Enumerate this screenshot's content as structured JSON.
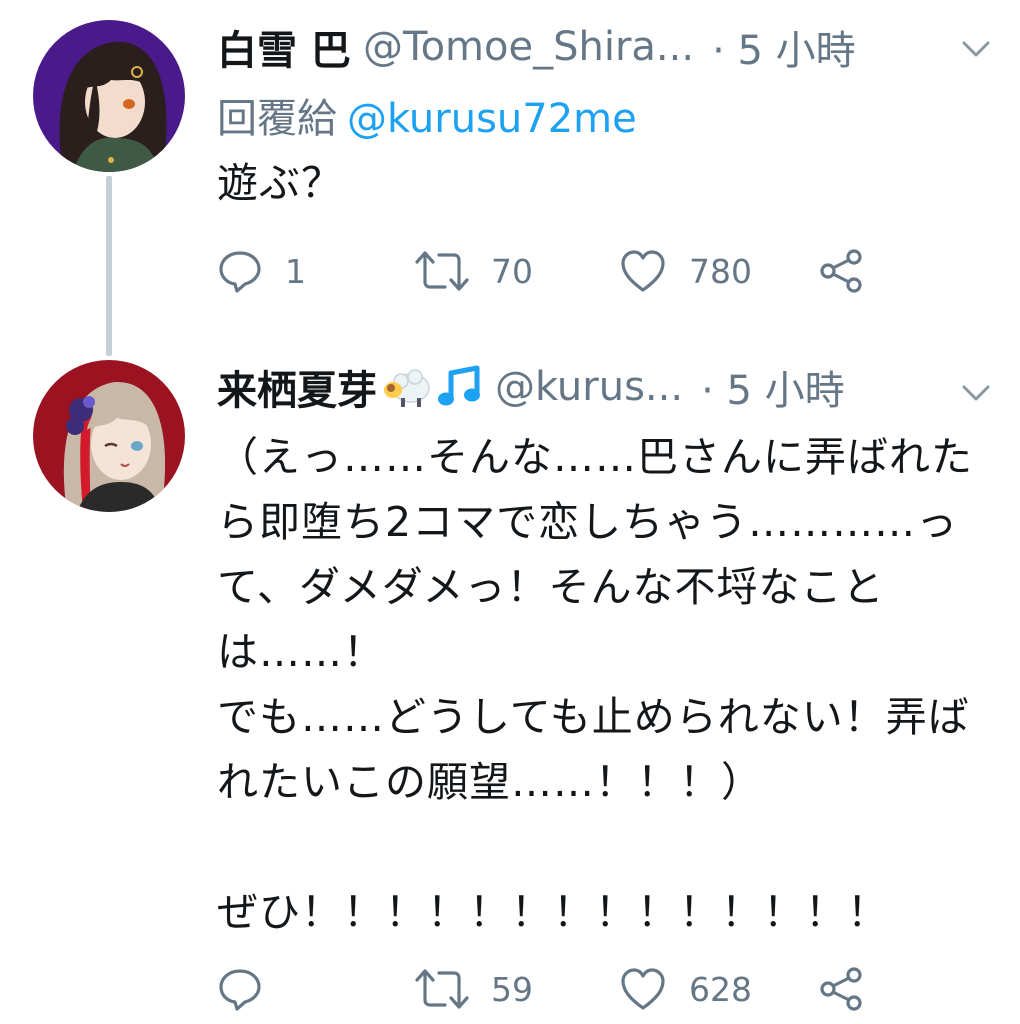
{
  "tweets": [
    {
      "display_name": "白雪 巴",
      "handle": "@Tomoe_Shira...",
      "time": "· 5 小時",
      "reply_label": "回覆給",
      "reply_mention": "@kurusu72me",
      "text": "遊ぶ？",
      "replies": "1",
      "retweets": "70",
      "likes": "780",
      "avatar_colors": {
        "bg": "#4a1a8a",
        "hair": "#2a1f1c",
        "skin": "#f4dccd",
        "outfit": "#3e5a45"
      }
    },
    {
      "display_name": "来栖夏芽",
      "emoji": [
        "sheep-emoji",
        "music-note-emoji"
      ],
      "handle": "@kurus...",
      "time": "· 5 小時",
      "text": "（えっ……そんな……巴さんに弄ばれたら即堕ち2コマで恋しちゃう…………って、ダメダメっ！そんな不埒なことは……！\nでも……どうしても止められない！弄ばれたいこの願望……！！！）\n\nぜひ！！！！！！！！！！！！！！",
      "replies": "",
      "retweets": "59",
      "likes": "628",
      "avatar_colors": {
        "bg": "#9b1220",
        "hair": "#c9b8a8",
        "skin": "#f6e3d8",
        "outfit": "#2a2a2a"
      }
    }
  ],
  "colors": {
    "text": "#14171a",
    "secondary": "#657786",
    "link": "#1da1f2",
    "thread_line": "#c4cfd6",
    "music_note": "#1da1f2"
  }
}
